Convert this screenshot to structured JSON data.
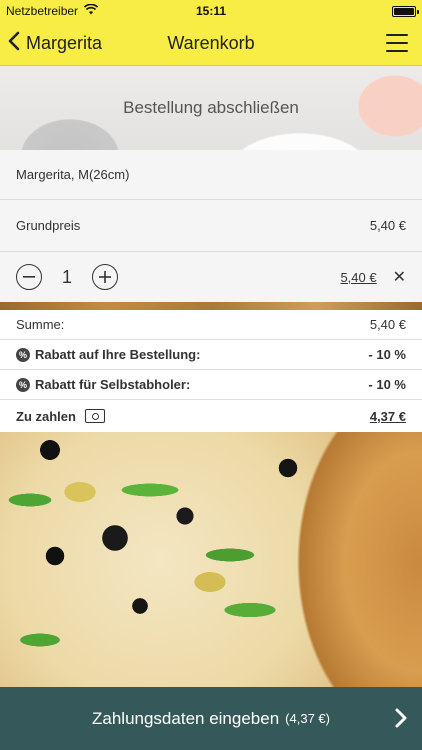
{
  "status_bar": {
    "carrier": "Netzbetreiber",
    "time": "15:11"
  },
  "nav": {
    "back_label": "Margerita",
    "title": "Warenkorb"
  },
  "hero": {
    "title": "Bestellung abschließen"
  },
  "cart_item": {
    "name": "Margerita, M(26cm)",
    "base_price_label": "Grundpreis",
    "base_price": "5,40 €",
    "quantity": "1",
    "line_total": "5,40 €"
  },
  "summary": {
    "sum_label": "Summe:",
    "sum_value": "5,40 €",
    "discount1_label": "Rabatt auf Ihre Bestellung:",
    "discount1_value": "- 10 %",
    "discount2_label": "Rabatt für Selbstabholer:",
    "discount2_value": "- 10 %",
    "total_label": "Zu zahlen",
    "total_value": "4,37 €"
  },
  "footer": {
    "button_label": "Zahlungsdaten eingeben",
    "button_amount": "(4,37 €)"
  },
  "colors": {
    "accent_yellow": "#f7ed45",
    "footer_teal": "#35595a"
  },
  "icons": [
    "wifi-icon",
    "battery-icon",
    "back-chevron-icon",
    "menu-icon",
    "minus-icon",
    "plus-icon",
    "remove-icon",
    "discount-icon",
    "cash-icon",
    "forward-chevron-icon"
  ]
}
